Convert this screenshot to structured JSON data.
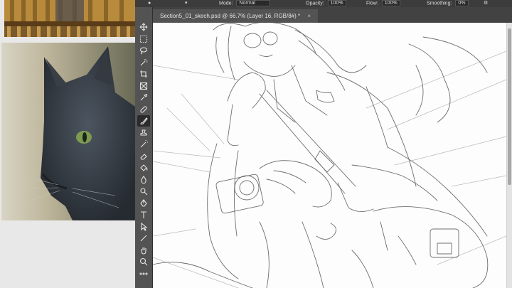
{
  "options_bar": {
    "mode_label": "Mode:",
    "mode_value": "Normal",
    "opacity_label": "Opacity:",
    "opacity_value": "100%",
    "flow_label": "Flow:",
    "flow_value": "100%",
    "smoothing_label": "Smoothing:",
    "smoothing_value": "0%"
  },
  "document": {
    "tab_title": "Section5_01_skech.psd @ 66.7% (Layer 16, RGB/8#) *",
    "close_glyph": "×"
  },
  "tools": [
    {
      "name": "move-tool",
      "icon": "move-icon"
    },
    {
      "name": "marquee-tool",
      "icon": "marquee-icon"
    },
    {
      "name": "lasso-tool",
      "icon": "lasso-icon"
    },
    {
      "name": "magic-wand-tool",
      "icon": "magic-wand-icon"
    },
    {
      "name": "crop-tool",
      "icon": "crop-icon"
    },
    {
      "name": "frame-tool",
      "icon": "frame-icon"
    },
    {
      "name": "eyedropper-tool",
      "icon": "eyedropper-icon"
    },
    {
      "name": "healing-brush-tool",
      "icon": "bandage-icon"
    },
    {
      "name": "brush-tool",
      "icon": "brush-icon",
      "active": true
    },
    {
      "name": "clone-stamp-tool",
      "icon": "stamp-icon"
    },
    {
      "name": "history-brush-tool",
      "icon": "history-brush-icon"
    },
    {
      "name": "eraser-tool",
      "icon": "eraser-icon"
    },
    {
      "name": "paint-bucket-tool",
      "icon": "bucket-icon"
    },
    {
      "name": "blur-tool",
      "icon": "drop-icon"
    },
    {
      "name": "dodge-tool",
      "icon": "dodge-icon"
    },
    {
      "name": "pen-tool",
      "icon": "pen-icon"
    },
    {
      "name": "type-tool",
      "icon": "type-icon",
      "glyph": "T"
    },
    {
      "name": "path-selection-tool",
      "icon": "arrow-icon"
    },
    {
      "name": "line-tool",
      "icon": "line-icon"
    },
    {
      "name": "hand-tool",
      "icon": "hand-icon"
    },
    {
      "name": "zoom-tool",
      "icon": "zoom-icon"
    },
    {
      "name": "more-tools",
      "icon": "ellipsis-icon",
      "glyph": "•••"
    }
  ],
  "colors": {
    "toolbar_bg": "#535353",
    "options_bar_bg": "#3c3c3c",
    "canvas_bg": "#fdfdfd",
    "sketch_stroke": "#6e6e6e"
  }
}
